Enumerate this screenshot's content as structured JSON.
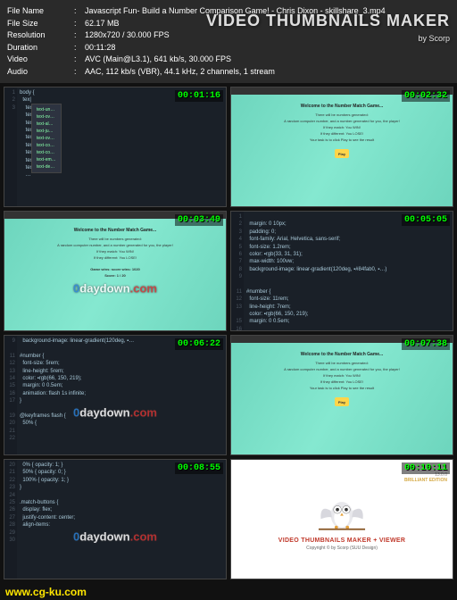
{
  "meta": {
    "labels": {
      "name": "File Name",
      "size": "File Size",
      "res": "Resolution",
      "dur": "Duration",
      "vid": "Video",
      "aud": "Audio"
    },
    "sep": ":",
    "name": "Javascript Fun- Build a Number Comparison Game! - Chris Dixon - skillshare_3.mp4",
    "size": "62.17 MB",
    "res": "1280x720 / 30.000 FPS",
    "dur": "00:11:28",
    "vid": "AVC (Main@L3.1), 641 kb/s, 30.000 FPS",
    "aud": "AAC, 112 kb/s (VBR), 44.1 kHz, 2 channels, 1 stream"
  },
  "maker": {
    "line1": "VIDEO THUMBNAILS MAKER",
    "line2": "by Scorp"
  },
  "watermark": {
    "zero": "0",
    "rest": "daydown",
    "dot": ".com"
  },
  "thumbs": [
    {
      "ts": "00:01:16",
      "kind": "ed1"
    },
    {
      "ts": "00:02:32",
      "kind": "web"
    },
    {
      "ts": "00:03:49",
      "kind": "web2"
    },
    {
      "ts": "00:05:05",
      "kind": "ed2"
    },
    {
      "ts": "00:06:22",
      "kind": "ed3"
    },
    {
      "ts": "00:07:38",
      "kind": "web"
    },
    {
      "ts": "00:08:55",
      "kind": "ed4"
    },
    {
      "ts": "00:10:11",
      "kind": "owl"
    }
  ],
  "webgame": {
    "title": "Welcome to the Number Match Game...",
    "l1": "There will be numbers generated:",
    "l2": "A random computer number, and a number generated for you, the player!",
    "l3": "If they match: You WIN!",
    "l4": "If they different: You LOSE!",
    "l5": "Your task is to click Play to see the result",
    "play": "Play",
    "score": "Game wins: score wins: 1020",
    "scoreB": "Score: 1 / 20"
  },
  "ed1": {
    "lines": [
      "1",
      "2",
      "3",
      "",
      "",
      "",
      "",
      "",
      "",
      "",
      "",
      "",
      ""
    ],
    "code": "body {\n  tex|\n    text-un…\n    text-ov…\n    text-al…\n    text-ju…\n    text-ov…\n    text-co…\n    text-co…\n    text-em…\n    text-de…\n    …"
  },
  "ed2": {
    "lines": [
      "1",
      "2",
      "3",
      "4",
      "5",
      "6",
      "7",
      "8",
      "9",
      "",
      "11",
      "12",
      "13",
      "",
      "15",
      "16"
    ],
    "code": "\n  margin: 0 10px;\n  padding: 0;\n  font-family: Arial, Helvetica, sans-serif;\n  font-size: 1.2rem;\n  color: ▪rgb(33, 31, 31);\n  max-width: 100vw;\n  background-image: linear-gradient(120deg, ▪#84fab0, ▪…)\n\n\n#number {\n  font-size: 11rem;\n  line-height: 7rem;\n  color: ▪rgb(66, 150, 219);\n  margin: 0 0.5em;"
  },
  "ed3": {
    "lines": [
      "9",
      "",
      "11",
      "12",
      "13",
      "14",
      "15",
      "16",
      "17",
      "",
      "19",
      "20",
      "21",
      "22"
    ],
    "code": "  background-image: linear-gradient(120deg, ▪…\n\n#number {\n  font-size: 5rem;\n  line-height: 5rem;\n  color: ▪rgb(66, 150, 219);\n  margin: 0 0.5em;\n  animation: flash 1s infinite;\n}\n\n@keyframes flash {\n  50% {\n"
  },
  "ed4": {
    "lines": [
      "20",
      "21",
      "22",
      "23",
      "24",
      "25",
      "26",
      "27",
      "28",
      "29",
      "30"
    ],
    "code": "  0% { opacity: 1; }\n  50% { opacity: 0; }\n  100% { opacity: 1; }\n}\n\n.match-buttons {\n  display: flex;\n  justify-content: center;\n  align-items:"
  },
  "owl": {
    "ver": "13.0.0",
    "ed": "BRILLIANT\nEDITION",
    "title": "VIDEO THUMBNAILS MAKER + VIEWER",
    "cr": "Copyright © by Scorp (SUU Design)"
  },
  "footer": "www.cg-ku.com"
}
